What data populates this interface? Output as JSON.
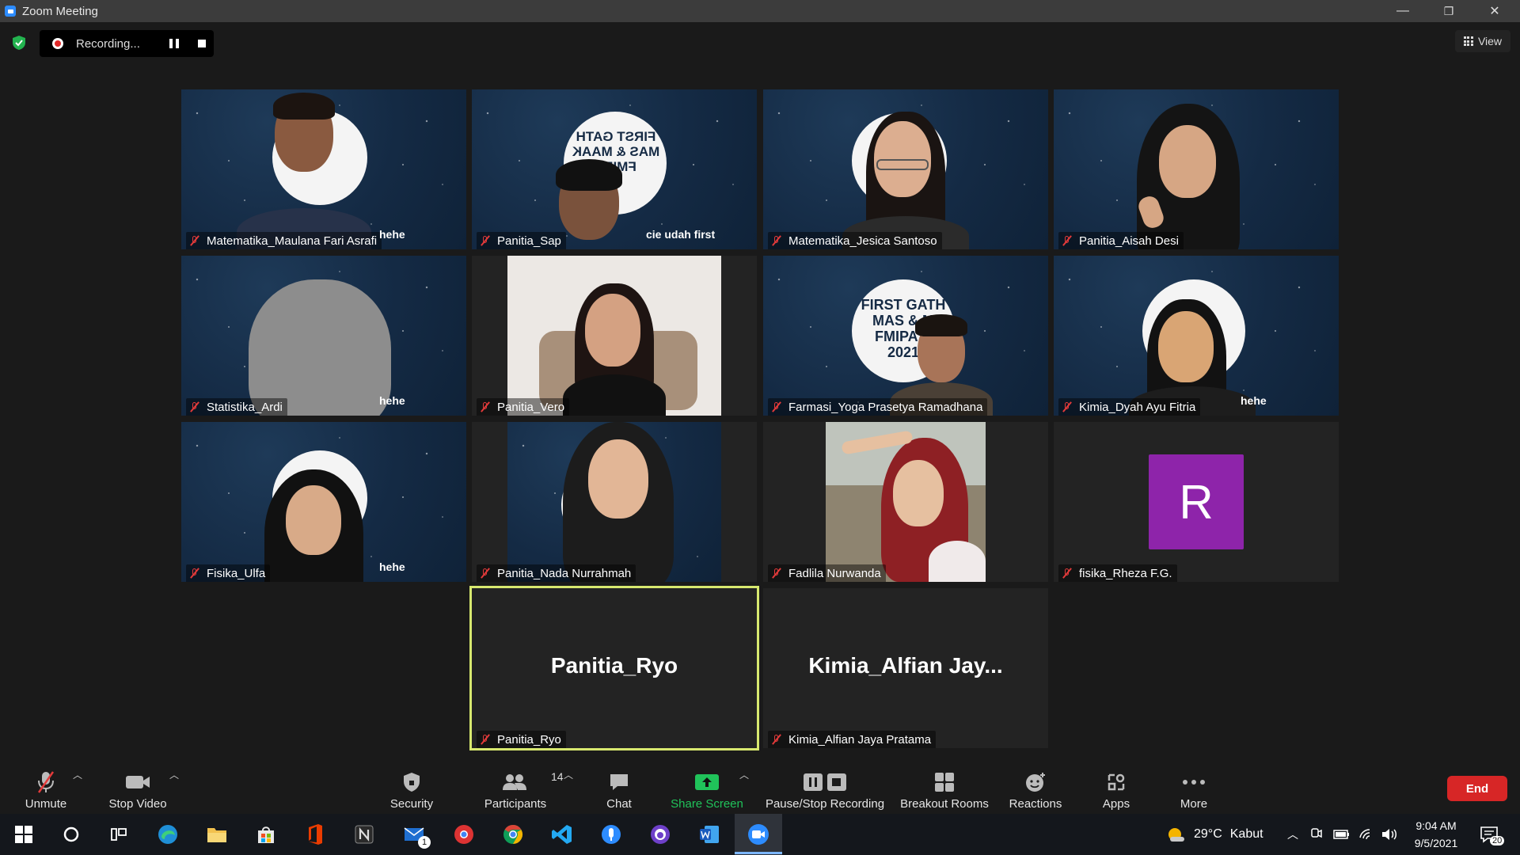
{
  "window": {
    "title": "Zoom Meeting",
    "controls": [
      "—",
      "❐",
      "✕"
    ]
  },
  "recording": {
    "status_text": "Recording..."
  },
  "view_button": {
    "label": "View"
  },
  "participants_tiles": [
    {
      "name": "Matematika_Maulana Fari Asrafi",
      "muted": true
    },
    {
      "name": "Panitia_Sap",
      "muted": true
    },
    {
      "name": "Matematika_Jesica Santoso",
      "muted": true
    },
    {
      "name": "Panitia_Aisah Desi",
      "muted": true
    },
    {
      "name": "Statistika_Ardi",
      "muted": true
    },
    {
      "name": "Panitia_Vero",
      "muted": true
    },
    {
      "name": "Farmasi_Yoga Prasetya Ramadhana",
      "muted": true
    },
    {
      "name": "Kimia_Dyah Ayu Fitria",
      "muted": true
    },
    {
      "name": "Fisika_Ulfa",
      "muted": true
    },
    {
      "name": "Panitia_Nada Nurrahmah",
      "muted": true
    },
    {
      "name": "Fadlila Nurwanda",
      "muted": true
    },
    {
      "name": "fisika_Rheza F.G.",
      "muted": true,
      "avatar_letter": "R",
      "avatar_color": "#8e24aa"
    },
    {
      "name": "Panitia_Ryo",
      "muted": true,
      "big_name": "Panitia_Ryo",
      "active_speaker": true
    },
    {
      "name": "Kimia_Alfian Jaya Pratama",
      "muted": true,
      "big_name": "Kimia_Alfian  Jay..."
    }
  ],
  "background_texts": {
    "moon_text_mirrored": "FIRST GATH\nMAS & MAAK\nFMIPA",
    "moon_text": "FIRST GATH\nMAS & M\nFMIPA U\n2021",
    "caption_hehe": "hehe",
    "caption_cie": "cie udah first"
  },
  "toolbar": {
    "unmute": "Unmute",
    "stop_video": "Stop Video",
    "security": "Security",
    "participants": "Participants",
    "participants_count": "14",
    "chat": "Chat",
    "share_screen": "Share Screen",
    "pause_stop_recording": "Pause/Stop Recording",
    "breakout_rooms": "Breakout Rooms",
    "reactions": "Reactions",
    "apps": "Apps",
    "more": "More",
    "end": "End"
  },
  "taskbar": {
    "weather_temp": "29°C",
    "weather_desc": "Kabut",
    "time": "9:04 AM",
    "date": "9/5/2021",
    "mail_badge": "1",
    "notifications_count": "20"
  },
  "colors": {
    "accent_share": "#20c35a",
    "end_red": "#d72626",
    "active_speaker": "#d7e86f",
    "muted_red": "#e23a3a"
  }
}
